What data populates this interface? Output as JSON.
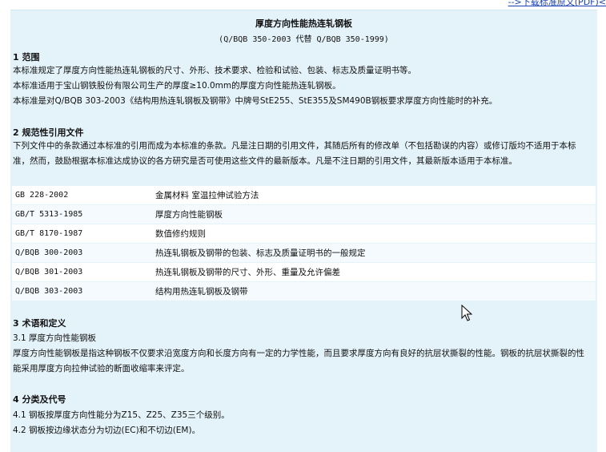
{
  "top": {
    "download_link": "-->下载标准原文(PDF)<"
  },
  "doc": {
    "title": "厚度方向性能热连轧钢板",
    "subtitle": "(Q/BQB 350-2003 代替 Q/BQB 350-1999)",
    "s1": {
      "heading": "1 范围",
      "p1": "本标准规定了厚度方向性能热连轧钢板的尺寸、外形、技术要求、检验和试验、包装、标志及质量证明书等。",
      "p2": "本标准适用于宝山钢铁股份有限公司生产的厚度≥10.0mm的厚度方向性能热连轧钢板。",
      "p3": "本标准是对Q/BQB 303-2003《结构用热连轧钢板及钢带》中牌号StE255、StE355及SM490B钢板要求厚度方向性能时的补充。"
    },
    "s2": {
      "heading": "2 规范性引用文件",
      "p1": "下列文件中的条款通过本标准的引用而成为本标准的条款。凡是注日期的引用文件，其随后所有的修改单（不包括勘误的内容）或修订版均不适用于本标准，然而，鼓励根据本标准达成协议的各方研究是否可使用这些文件的最新版本。凡是不注日期的引用文件，其最新版本适用于本标准。",
      "refs": [
        {
          "code": "GB 228-2002",
          "name": "金属材料 室温拉伸试验方法"
        },
        {
          "code": "GB/T 5313-1985",
          "name": "厚度方向性能钢板"
        },
        {
          "code": "GB/T 8170-1987",
          "name": "数值修约规则"
        },
        {
          "code": "Q/BQB 300-2003",
          "name": "热连轧钢板及钢带的包装、标志及质量证明书的一般规定"
        },
        {
          "code": "Q/BQB 301-2003",
          "name": "热连轧钢板及钢带的尺寸、外形、重量及允许偏差"
        },
        {
          "code": "Q/BQB 303-2003",
          "name": "结构用热连轧钢板及钢带"
        }
      ]
    },
    "s3": {
      "heading": "3 术语和定义",
      "sub": "3.1 厚度方向性能钢板",
      "p1": "厚度方向性能钢板是指这种钢板不仅要求沿宽度方向和长度方向有一定的力学性能，而且要求厚度方向有良好的抗层状撕裂的性能。钢板的抗层状撕裂的性能采用厚度方向拉伸试验的断面收缩率来评定。"
    },
    "s4": {
      "heading": "4 分类及代号",
      "p1": "4.1 钢板按厚度方向性能分为Z15、Z25、Z35三个级别。",
      "p2": "4.2 钢板按边缘状态分为切边(EC)和不切边(EM)。"
    }
  }
}
